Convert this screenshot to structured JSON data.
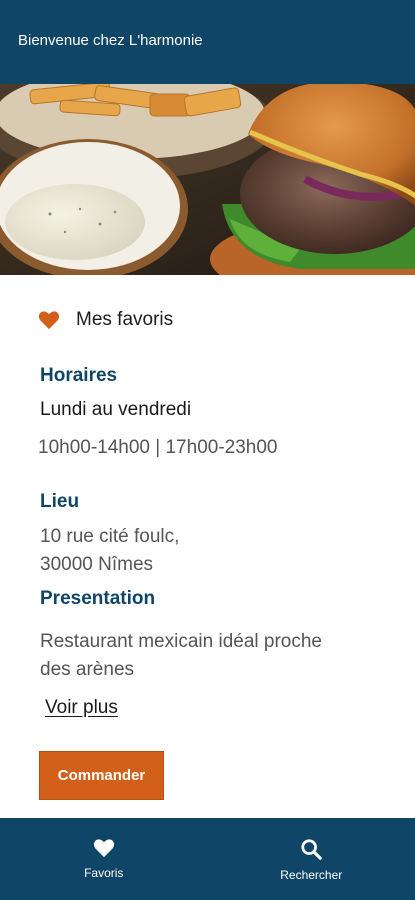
{
  "header": {
    "title": "Bienvenue chez L'harmonie"
  },
  "hero": {
    "image": "burger-fries-sauce-photo"
  },
  "favorite": {
    "icon": "heart-icon",
    "label": "Mes favoris"
  },
  "hours": {
    "title": "Horaires",
    "days": "Lundi au vendredi",
    "times": "10h00-14h00 | 17h00-23h00"
  },
  "location": {
    "title": "Lieu",
    "line1": "10 rue cité foulc,",
    "line2": "30000 Nîmes"
  },
  "presentation": {
    "title": "Presentation",
    "line1": "Restaurant mexicain idéal proche",
    "line2": "des arènes",
    "more_label": "Voir plus"
  },
  "order": {
    "label": "Commander"
  },
  "bottom_nav": {
    "items": [
      {
        "icon": "heart-icon",
        "label": "Favoris"
      },
      {
        "icon": "search-icon",
        "label": "Rechercher"
      }
    ]
  },
  "colors": {
    "primary": "#0f4566",
    "accent": "#d2601a",
    "text_grey": "#555555"
  }
}
